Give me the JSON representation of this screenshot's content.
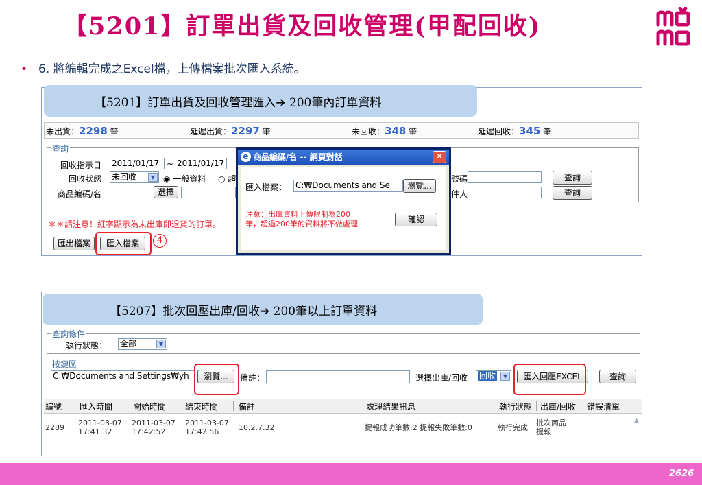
{
  "slide": {
    "title": "【5201】訂單出貨及回收管理(甲配回收)",
    "bullet_text": "6. 將編輯完成之Excel檔，上傳檔案批次匯入系統。",
    "bullet_symbol": "•",
    "page_number": "2626",
    "logo_text": "momo",
    "colors": {
      "title": "#cc0066",
      "footer": "#ee66cc",
      "banner": "#bcd4ee",
      "highlight": "#e8202a",
      "stat_number": "#3366cc"
    }
  },
  "top_panel": {
    "banner": "【5201】訂單出貨及回收管理匯入➔ 200筆內訂單資料",
    "stats": [
      {
        "label": "未出貨：",
        "value": "2298",
        "unit": " 筆"
      },
      {
        "label": "延遲出貨：",
        "value": "2297",
        "unit": " 筆"
      },
      {
        "label": "未回收：",
        "value": "348",
        "unit": " 筆"
      },
      {
        "label": "延遲回收：",
        "value": "345",
        "unit": " 筆"
      }
    ],
    "query": {
      "legend": "查詢",
      "recall_date_label": "回收指示日",
      "date_from": "2011/01/17",
      "date_sep": "~",
      "date_to": "2011/01/17",
      "recall_status_label": "回收狀態",
      "recall_status_value": "未回收",
      "radio_general": "一般資料",
      "radio_other": "超",
      "product_label": "商品編碼/名",
      "select_button": "選擇",
      "right_label_1": "號碼",
      "right_label_2": "件人",
      "query_button_1": "查詢",
      "query_button_2": "查詢"
    },
    "notice": "＊＊請注意！紅字顯示為未出庫即退貨的訂單。",
    "export_button": "匯出檔案",
    "import_button": "匯入檔案",
    "step_marker": "4"
  },
  "dialog": {
    "title": "商品編碼/名 -- 網頁對話",
    "ie_icon": "e",
    "close_icon": "✕",
    "import_label": "匯入檔案：",
    "file_value": "C:₩Documents and Se",
    "browse_button": "瀏覽...",
    "warning_line1": "注意：出庫資料上傳限制為200",
    "warning_line2": "筆，超過200筆的資料將不做處理",
    "confirm_button": "確認"
  },
  "bottom_panel": {
    "banner": "【5207】批次回壓出庫/回收➔ 200筆以上訂單資料",
    "query_legend": "查詢條件",
    "exec_status_label": "執行狀態：",
    "exec_status_value": "全部",
    "key_legend": "按鍵區",
    "file_value": "C:₩Documents and Settings₩yh",
    "browse_button": "瀏覽...",
    "remark_label": "備註：",
    "select_label": "選擇出庫/回收",
    "select_value": "回收",
    "import_excel_button": "匯入回壓EXCEL",
    "query_button": "查詢",
    "columns": [
      "編號",
      "匯入時間",
      "開始時間",
      "結束時間",
      "備註",
      "處理結果訊息",
      "執行狀態",
      "出庫/回收",
      "錯誤清單"
    ],
    "rows": [
      {
        "id": "2289",
        "import_date": "2011-03-07",
        "import_time": "17:41:32",
        "start_date": "2011-03-07",
        "start_time": "17:42:52",
        "end_date": "2011-03-07",
        "end_time": "17:42:56",
        "remark": "10.2.7.32",
        "result_success": "提報成功筆數:2",
        "result_fail": "提報失敗筆數:0",
        "status": "執行完成",
        "type_line1": "批次商品",
        "type_line2": "提報"
      }
    ]
  }
}
